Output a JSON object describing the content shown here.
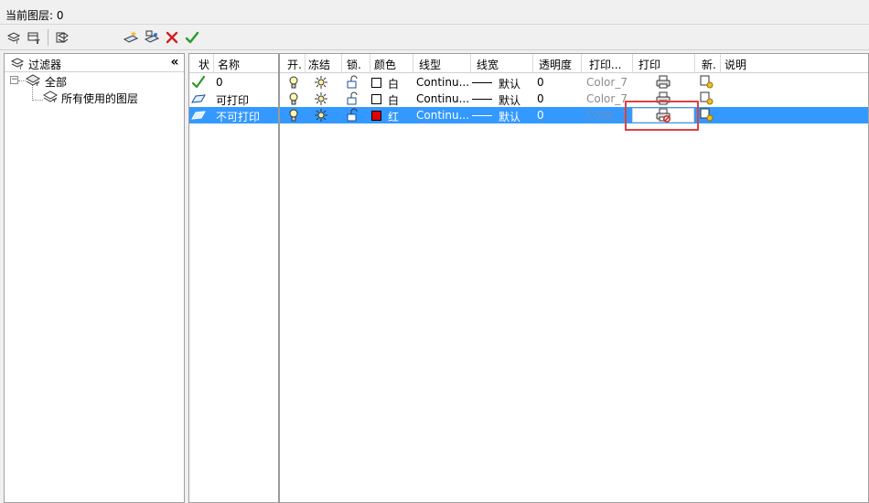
{
  "header": {
    "current_layer": "当前图层: 0"
  },
  "toolbar": {
    "buttons": [
      "new-property-filter",
      "new-group-filter",
      "layer-states-manager",
      "new-layer",
      "new-layer-vp-frozen",
      "delete-layer",
      "set-current"
    ]
  },
  "filters": {
    "title": "过滤器",
    "collapse": "«",
    "tree": [
      {
        "label": "全部",
        "expander": "−"
      },
      {
        "label": "所有使用的图层"
      }
    ]
  },
  "columns": [
    "状",
    "名称",
    "开.",
    "冻结",
    "锁.",
    "颜色",
    "线型",
    "线宽",
    "透明度",
    "打印...",
    "打印",
    "新.",
    "说明"
  ],
  "layers": [
    {
      "status": "current",
      "name": "0",
      "color_name": "白",
      "color_hex": "#ffffff",
      "linetype": "Continu...",
      "lineweight": "默认",
      "transparency": "0",
      "plot_style": "Color_7",
      "plot": "printable",
      "selected": false
    },
    {
      "status": "layer",
      "name": "可打印",
      "color_name": "白",
      "color_hex": "#ffffff",
      "linetype": "Continu...",
      "lineweight": "默认",
      "transparency": "0",
      "plot_style": "Color_7",
      "plot": "printable",
      "selected": false
    },
    {
      "status": "layer",
      "name": "不可打印",
      "color_name": "红",
      "color_hex": "#e00000",
      "linetype": "Continu...",
      "lineweight": "默认",
      "transparency": "0",
      "plot_style": "Color_7",
      "plot": "no-plot",
      "selected": true
    }
  ],
  "colors": {
    "selection": "#3399ff",
    "highlight": "#e04040",
    "check": "#2a9a2a",
    "delete": "#d02020"
  }
}
